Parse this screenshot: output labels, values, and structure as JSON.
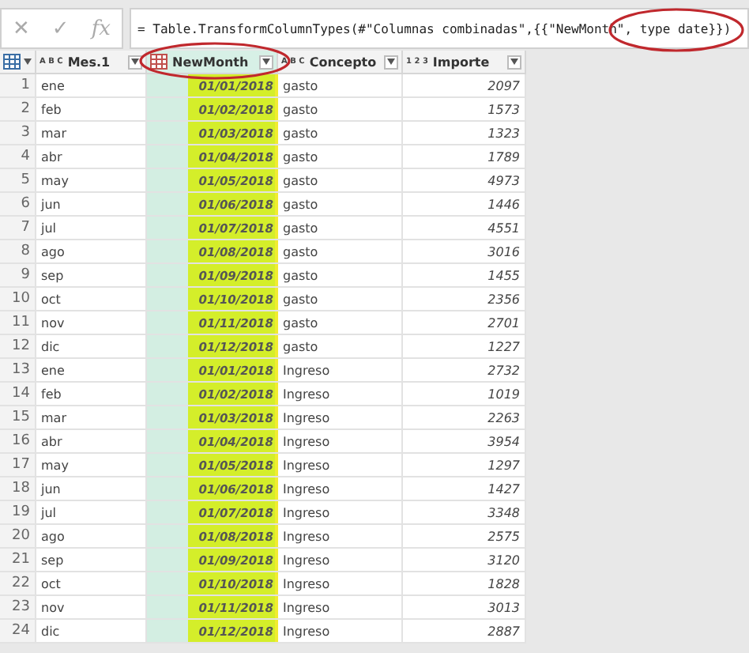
{
  "formula_bar": {
    "cancel": "✕",
    "confirm": "✓",
    "fx": "fx",
    "formula": "= Table.TransformColumnTypes(#\"Columnas combinadas\",{{\"NewMonth\", type date}})"
  },
  "table": {
    "columns": [
      {
        "type_label": "A B C",
        "label": "Mes.1",
        "kind": "text",
        "selected": false
      },
      {
        "label": "NewMonth",
        "kind": "date",
        "selected": true
      },
      {
        "type_label": "A B C",
        "label": "Concepto",
        "kind": "text",
        "selected": false
      },
      {
        "type_label": "1 2 3",
        "label": "Importe",
        "kind": "number",
        "selected": false
      }
    ],
    "rows": [
      {
        "n": "1",
        "cells": [
          "ene",
          "01/01/2018",
          "gasto",
          "2097"
        ]
      },
      {
        "n": "2",
        "cells": [
          "feb",
          "01/02/2018",
          "gasto",
          "1573"
        ]
      },
      {
        "n": "3",
        "cells": [
          "mar",
          "01/03/2018",
          "gasto",
          "1323"
        ]
      },
      {
        "n": "4",
        "cells": [
          "abr",
          "01/04/2018",
          "gasto",
          "1789"
        ]
      },
      {
        "n": "5",
        "cells": [
          "may",
          "01/05/2018",
          "gasto",
          "4973"
        ]
      },
      {
        "n": "6",
        "cells": [
          "jun",
          "01/06/2018",
          "gasto",
          "1446"
        ]
      },
      {
        "n": "7",
        "cells": [
          "jul",
          "01/07/2018",
          "gasto",
          "4551"
        ]
      },
      {
        "n": "8",
        "cells": [
          "ago",
          "01/08/2018",
          "gasto",
          "3016"
        ]
      },
      {
        "n": "9",
        "cells": [
          "sep",
          "01/09/2018",
          "gasto",
          "1455"
        ]
      },
      {
        "n": "10",
        "cells": [
          "oct",
          "01/10/2018",
          "gasto",
          "2356"
        ]
      },
      {
        "n": "11",
        "cells": [
          "nov",
          "01/11/2018",
          "gasto",
          "2701"
        ]
      },
      {
        "n": "12",
        "cells": [
          "dic",
          "01/12/2018",
          "gasto",
          "1227"
        ]
      },
      {
        "n": "13",
        "cells": [
          "ene",
          "01/01/2018",
          "Ingreso",
          "2732"
        ]
      },
      {
        "n": "14",
        "cells": [
          "feb",
          "01/02/2018",
          "Ingreso",
          "1019"
        ]
      },
      {
        "n": "15",
        "cells": [
          "mar",
          "01/03/2018",
          "Ingreso",
          "2263"
        ]
      },
      {
        "n": "16",
        "cells": [
          "abr",
          "01/04/2018",
          "Ingreso",
          "3954"
        ]
      },
      {
        "n": "17",
        "cells": [
          "may",
          "01/05/2018",
          "Ingreso",
          "1297"
        ]
      },
      {
        "n": "18",
        "cells": [
          "jun",
          "01/06/2018",
          "Ingreso",
          "1427"
        ]
      },
      {
        "n": "19",
        "cells": [
          "jul",
          "01/07/2018",
          "Ingreso",
          "3348"
        ]
      },
      {
        "n": "20",
        "cells": [
          "ago",
          "01/08/2018",
          "Ingreso",
          "2575"
        ]
      },
      {
        "n": "21",
        "cells": [
          "sep",
          "01/09/2018",
          "Ingreso",
          "3120"
        ]
      },
      {
        "n": "22",
        "cells": [
          "oct",
          "01/10/2018",
          "Ingreso",
          "1828"
        ]
      },
      {
        "n": "23",
        "cells": [
          "nov",
          "01/11/2018",
          "Ingreso",
          "3013"
        ]
      },
      {
        "n": "24",
        "cells": [
          "dic",
          "01/12/2018",
          "Ingreso",
          "2887"
        ]
      }
    ]
  }
}
